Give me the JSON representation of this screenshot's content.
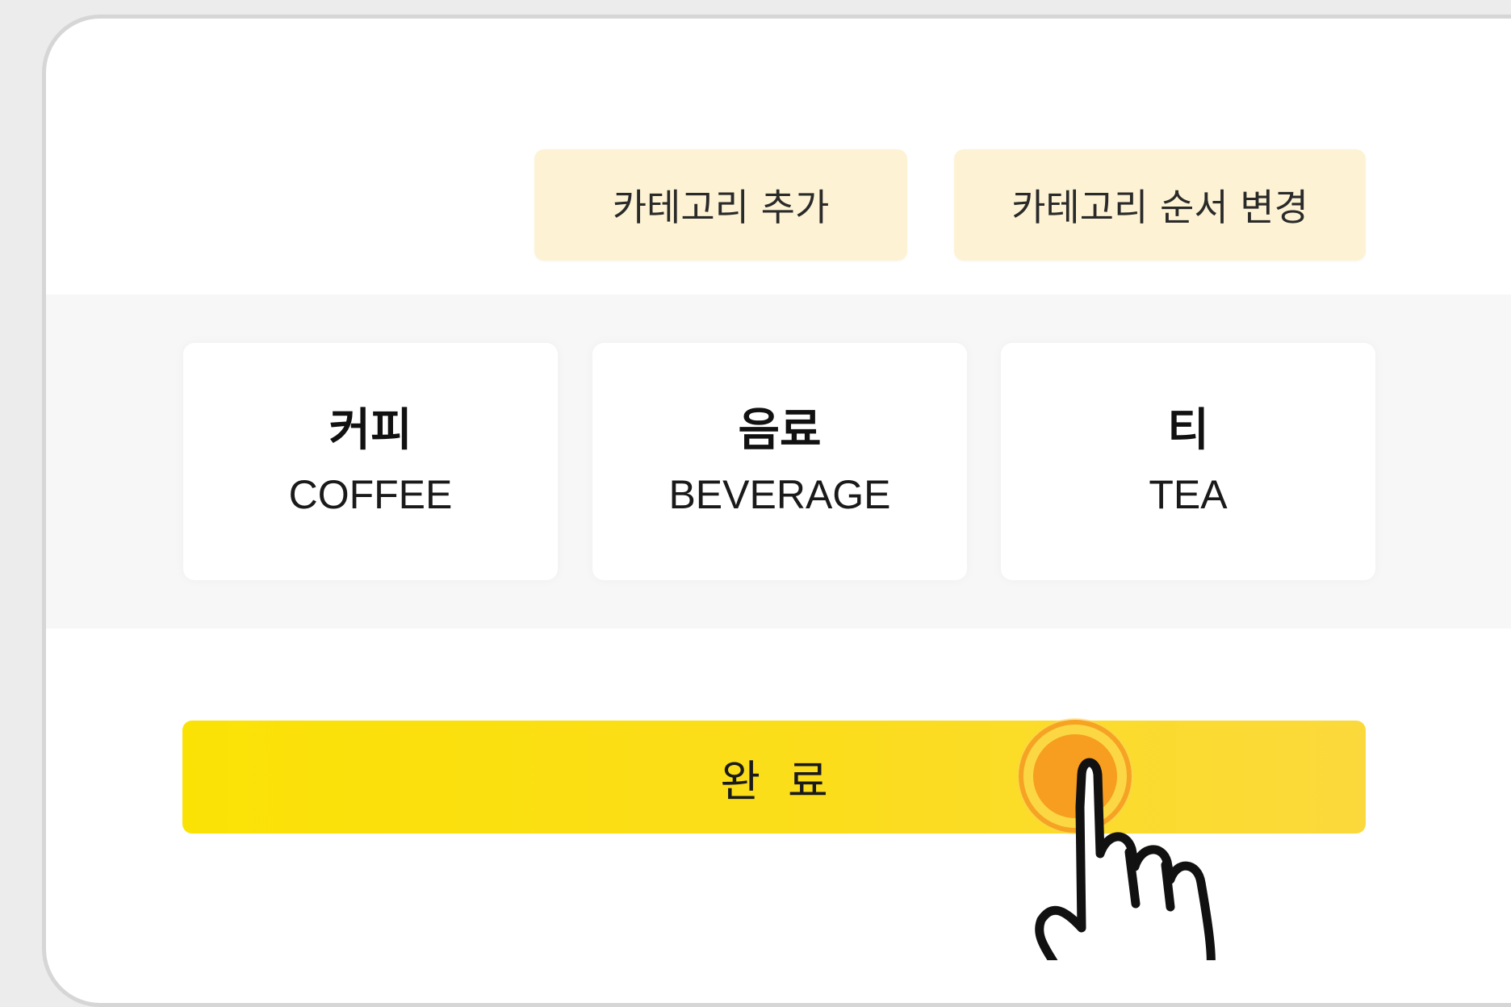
{
  "toolbar": {
    "add_category_label": "카테고리 추가",
    "reorder_category_label": "카테고리 순서 변경"
  },
  "categories": [
    {
      "name_ko": "커피",
      "name_en": "COFFEE"
    },
    {
      "name_ko": "음료",
      "name_en": "BEVERAGE"
    },
    {
      "name_ko": "티",
      "name_en": "TEA"
    }
  ],
  "footer": {
    "done_label": "완료"
  },
  "colors": {
    "accent_yellow": "#FBE205",
    "secondary_button_bg": "#FDF3D4",
    "tap_indicator": "#F9A21B"
  },
  "icons": {
    "tap_cursor": "hand-pointer-icon",
    "tap_ring": "tap-indicator-icon"
  }
}
